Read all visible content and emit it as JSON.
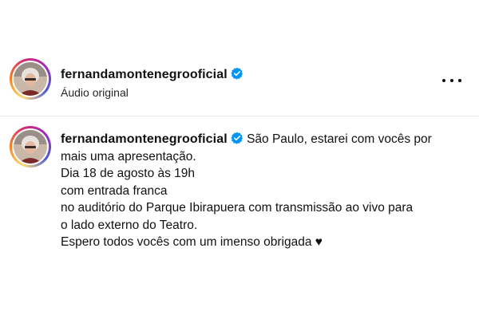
{
  "header": {
    "username": "fernandamontenegrooficial",
    "subtitle": "Áudio original"
  },
  "caption": {
    "username": "fernandamontenegrooficial",
    "first_text": "São Paulo, estarei com vocês por",
    "lines": [
      "mais uma apresentação.",
      "Dia 18 de agosto às 19h",
      "com entrada franca",
      "no auditório do Parque Ibirapuera com transmissão ao vivo para",
      "o lado externo do Teatro.",
      "Espero todos vocês com um imenso obrigada ♥"
    ]
  },
  "icons": {
    "verified": "verified-badge-icon",
    "more": "more-options-icon"
  },
  "colors": {
    "verified": "#0095f6",
    "text": "#111111",
    "divider": "#e6e6e6"
  }
}
